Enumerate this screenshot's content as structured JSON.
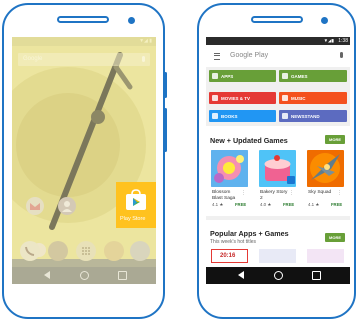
{
  "left_phone": {
    "search_placeholder": "Google",
    "play_store_label": "Play Store"
  },
  "right_phone": {
    "status": {
      "time": "1:38"
    },
    "search_placeholder": "Google Play",
    "categories": [
      {
        "label": "APPS",
        "color": "#689f38"
      },
      {
        "label": "GAMES",
        "color": "#689f38"
      },
      {
        "label": "MOVIES & TV",
        "color": "#e53935"
      },
      {
        "label": "MUSIC",
        "color": "#f4511e"
      },
      {
        "label": "BOOKS",
        "color": "#2196f3"
      },
      {
        "label": "NEWSSTAND",
        "color": "#5c6bc0"
      }
    ],
    "section1": {
      "title": "New + Updated Games",
      "more": "MORE"
    },
    "games": [
      {
        "name1": "Blossom",
        "name2": "Blast Saga",
        "rating": "4.1 ★",
        "price": "FREE"
      },
      {
        "name1": "Bakery Story",
        "name2": "2",
        "rating": "4.0 ★",
        "price": "FREE"
      },
      {
        "name1": "Sky Squad",
        "name2": "",
        "rating": "4.1 ★",
        "price": "FREE"
      }
    ],
    "section2": {
      "title": "Popular Apps + Games",
      "subtitle": "This week's hot titles",
      "more": "MORE",
      "thumb_text": "20:16"
    }
  },
  "colors": {
    "accent_blue": "#1f74c4",
    "play_green": "#689f38",
    "more_button": "#689f38"
  }
}
